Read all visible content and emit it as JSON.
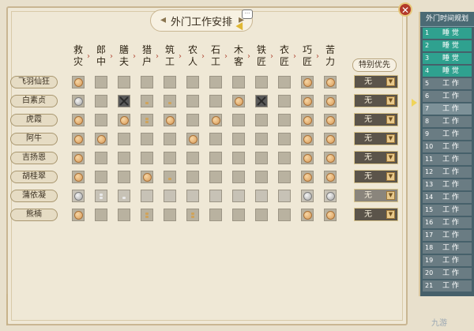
{
  "window": {
    "title": "外门工作安排",
    "close_icon": "close-icon"
  },
  "columns": [
    {
      "line1": "救",
      "line2": "灾"
    },
    {
      "line1": "郎",
      "line2": "中"
    },
    {
      "line1": "膳",
      "line2": "夫"
    },
    {
      "line1": "猎",
      "line2": "户"
    },
    {
      "line1": "筑",
      "line2": "工"
    },
    {
      "line1": "农",
      "line2": "人"
    },
    {
      "line1": "石",
      "line2": "工"
    },
    {
      "line1": "木",
      "line2": "客"
    },
    {
      "line1": "铁",
      "line2": "匠"
    },
    {
      "line1": "衣",
      "line2": "匠"
    },
    {
      "line1": "巧",
      "line2": "匠"
    },
    {
      "line1": "苦",
      "line2": "力"
    }
  ],
  "priority_header": "特别优先",
  "rows": [
    {
      "name": "飞羽仙狂",
      "priority": "无",
      "cells": [
        "token",
        "",
        "",
        "",
        "",
        "",
        "",
        "",
        "",
        "",
        "token",
        "token"
      ]
    },
    {
      "name": "白素贞",
      "priority": "无",
      "cells": [
        "silver",
        "",
        "blocked",
        "dots1",
        "dots1",
        "",
        "",
        "token",
        "blocked",
        "",
        "token",
        "token"
      ]
    },
    {
      "name": "虎霞",
      "priority": "无",
      "cells": [
        "token",
        "",
        "token",
        "dots2",
        "token",
        "",
        "token",
        "",
        "",
        "",
        "token",
        "token"
      ]
    },
    {
      "name": "阿牛",
      "priority": "无",
      "cells": [
        "token",
        "token",
        "",
        "",
        "",
        "token",
        "",
        "",
        "",
        "",
        "token",
        "token"
      ]
    },
    {
      "name": "吉扬恩",
      "priority": "无",
      "cells": [
        "token",
        "",
        "",
        "",
        "",
        "",
        "",
        "",
        "",
        "",
        "token",
        "token"
      ]
    },
    {
      "name": "胡桂翠",
      "priority": "无",
      "cells": [
        "token",
        "",
        "",
        "token",
        "dots1",
        "",
        "",
        "",
        "",
        "",
        "token",
        "token"
      ]
    },
    {
      "name": "蒲依凝",
      "priority": "无",
      "cells": [
        "silver",
        "dots2s",
        "dots1s",
        "",
        "",
        "",
        "",
        "",
        "",
        "",
        "silver",
        "silver"
      ]
    },
    {
      "name": "熊楠",
      "priority": "无",
      "cells": [
        "token",
        "",
        "",
        "dots2",
        "",
        "dots2",
        "",
        "",
        "",
        "",
        "token",
        "token"
      ]
    }
  ],
  "schedule": {
    "title": "外门时间规划",
    "items": [
      {
        "num": "1",
        "activity": "睡 觉",
        "kind": "sleep"
      },
      {
        "num": "2",
        "activity": "睡 觉",
        "kind": "sleep"
      },
      {
        "num": "3",
        "activity": "睡 觉",
        "kind": "sleep"
      },
      {
        "num": "4",
        "activity": "睡 觉",
        "kind": "sleep"
      },
      {
        "num": "5",
        "activity": "工 作",
        "kind": "work"
      },
      {
        "num": "6",
        "activity": "工 作",
        "kind": "work"
      },
      {
        "num": "7",
        "activity": "工 作",
        "kind": "current"
      },
      {
        "num": "8",
        "activity": "工 作",
        "kind": "work"
      },
      {
        "num": "9",
        "activity": "工 作",
        "kind": "work"
      },
      {
        "num": "10",
        "activity": "工 作",
        "kind": "work"
      },
      {
        "num": "11",
        "activity": "工 作",
        "kind": "work"
      },
      {
        "num": "12",
        "activity": "工 作",
        "kind": "work"
      },
      {
        "num": "13",
        "activity": "工 作",
        "kind": "work"
      },
      {
        "num": "14",
        "activity": "工 作",
        "kind": "work"
      },
      {
        "num": "15",
        "activity": "工 作",
        "kind": "work"
      },
      {
        "num": "16",
        "activity": "工 作",
        "kind": "work"
      },
      {
        "num": "17",
        "activity": "工 作",
        "kind": "work"
      },
      {
        "num": "18",
        "activity": "工 作",
        "kind": "work"
      },
      {
        "num": "19",
        "activity": "工 作",
        "kind": "work"
      },
      {
        "num": "20",
        "activity": "工 作",
        "kind": "work"
      },
      {
        "num": "21",
        "activity": "工 作",
        "kind": "work"
      }
    ]
  },
  "watermark": "九游"
}
